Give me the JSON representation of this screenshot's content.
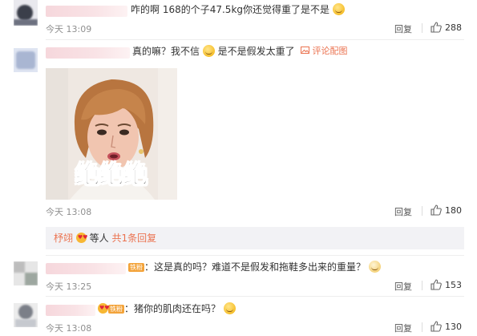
{
  "comments": [
    {
      "text": "咋的啊 168的个子47.5kg你还觉得重了是不是",
      "time": "今天 13:09",
      "reply_label": "回复",
      "likes": "288"
    },
    {
      "text_a": "真的嘛？我不信",
      "text_b": "是不是假发太重了",
      "pic_link": "评论配图",
      "meme_caption": "绝绝绝",
      "time": "今天 13:08",
      "reply_label": "回复",
      "likes": "180",
      "sub_user": "杼翊",
      "sub_mid": "等人",
      "sub_count": "共1条回复"
    },
    {
      "badge": "铁粉",
      "text": "：这是真的吗？难道不是假发和拖鞋多出来的重量？",
      "time": "今天 13:25",
      "reply_label": "回复",
      "likes": "153"
    },
    {
      "badge": "铁粉",
      "text": "：猪你的肌肉还在吗？",
      "time": "今天 13:08",
      "reply_label": "回复",
      "likes": "130"
    }
  ]
}
